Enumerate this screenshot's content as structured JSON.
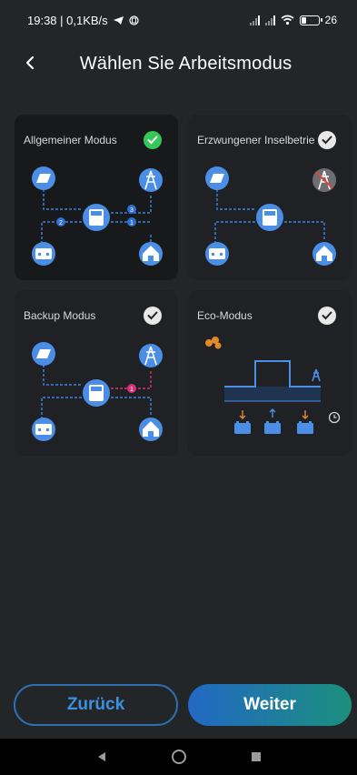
{
  "status": {
    "time_speed": "19:38 | 0,1KB/s",
    "battery": "26"
  },
  "header": {
    "title": "Wählen Sie Arbeitsmodus"
  },
  "modes": [
    {
      "label": "Allgemeiner Modus",
      "selected": true,
      "step_numbers": [
        "3",
        "2",
        "1"
      ]
    },
    {
      "label": "Erzwungener Inselbetrieb",
      "selected": false
    },
    {
      "label": "Backup Modus",
      "selected": false,
      "step_numbers": [
        "1"
      ]
    },
    {
      "label": "Eco-Modus",
      "selected": false
    }
  ],
  "buttons": {
    "back": "Zurück",
    "next": "Weiter"
  },
  "colors": {
    "accent": "#3d8fe0",
    "icon_bg": "#4a8ee6",
    "check_on": "#35c75a",
    "eco_orange": "#e28a2b",
    "backup_pink": "#d6337a"
  }
}
